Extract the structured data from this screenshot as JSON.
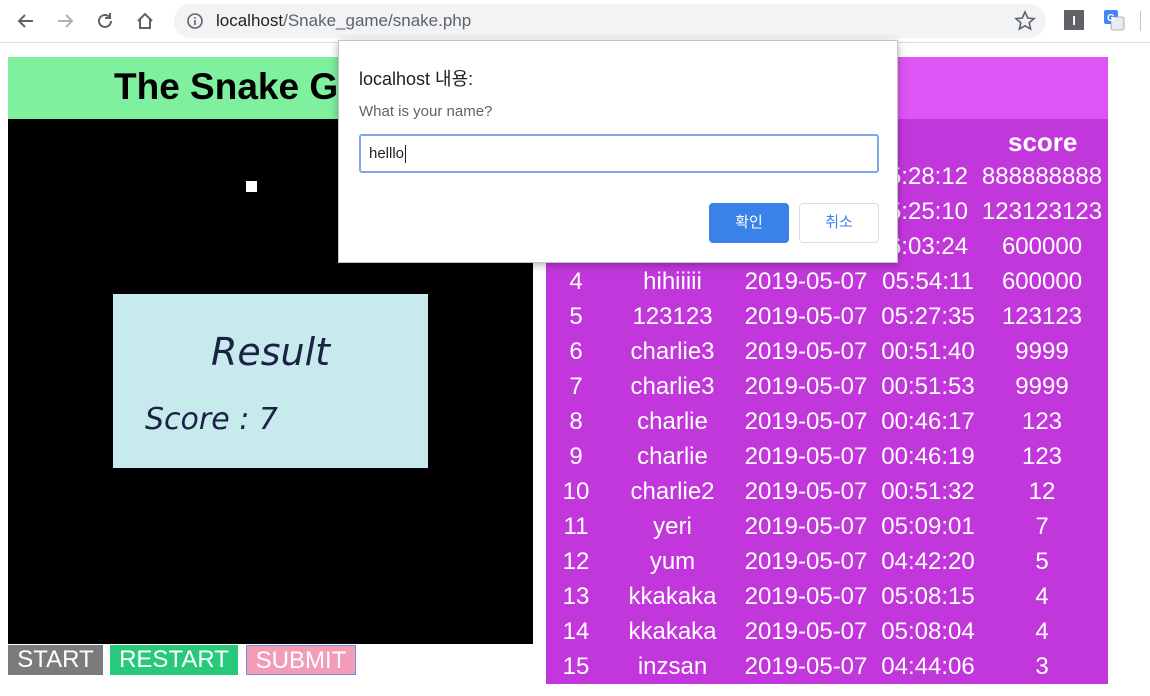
{
  "browser": {
    "url_host": "localhost",
    "url_path": "/Snake_game/snake.php",
    "extension_1_label": "I"
  },
  "game": {
    "title": "The Snake Game",
    "result_title": "Result",
    "result_score": "Score : 7",
    "buttons": {
      "start": "START",
      "restart": "RESTART",
      "submit": "SUBMIT"
    },
    "colors": {
      "header": "#7ef09e",
      "canvas": "#000000",
      "result_box": "#c7ebed"
    }
  },
  "scoreboard": {
    "score_header": "score",
    "rows": [
      {
        "rank": "",
        "name": "",
        "date": "",
        "time": "5:28:12",
        "score": "888888888"
      },
      {
        "rank": "",
        "name": "",
        "date": "",
        "time": "5:25:10",
        "score": "123123123"
      },
      {
        "rank": "",
        "name": "",
        "date": "",
        "time": "6:03:24",
        "score": "600000"
      },
      {
        "rank": "4",
        "name": "hihiiiii",
        "date": "2019-05-07",
        "time": "05:54:11",
        "score": "600000"
      },
      {
        "rank": "5",
        "name": "123123",
        "date": "2019-05-07",
        "time": "05:27:35",
        "score": "123123"
      },
      {
        "rank": "6",
        "name": "charlie3",
        "date": "2019-05-07",
        "time": "00:51:40",
        "score": "9999"
      },
      {
        "rank": "7",
        "name": "charlie3",
        "date": "2019-05-07",
        "time": "00:51:53",
        "score": "9999"
      },
      {
        "rank": "8",
        "name": "charlie",
        "date": "2019-05-07",
        "time": "00:46:17",
        "score": "123"
      },
      {
        "rank": "9",
        "name": "charlie",
        "date": "2019-05-07",
        "time": "00:46:19",
        "score": "123"
      },
      {
        "rank": "10",
        "name": "charlie2",
        "date": "2019-05-07",
        "time": "00:51:32",
        "score": "12"
      },
      {
        "rank": "11",
        "name": "yeri",
        "date": "2019-05-07",
        "time": "05:09:01",
        "score": "7"
      },
      {
        "rank": "12",
        "name": "yum",
        "date": "2019-05-07",
        "time": "04:42:20",
        "score": "5"
      },
      {
        "rank": "13",
        "name": "kkakaka",
        "date": "2019-05-07",
        "time": "05:08:15",
        "score": "4"
      },
      {
        "rank": "14",
        "name": "kkakaka",
        "date": "2019-05-07",
        "time": "05:08:04",
        "score": "4"
      },
      {
        "rank": "15",
        "name": "inzsan",
        "date": "2019-05-07",
        "time": "04:44:06",
        "score": "3"
      }
    ],
    "colors": {
      "header": "#dd55f4",
      "body": "#c237dc"
    }
  },
  "dialog": {
    "title": "localhost 내용:",
    "message": "What is your name?",
    "input_value": "helllo",
    "ok_label": "확인",
    "cancel_label": "취소",
    "accent": "#3b82e8"
  }
}
